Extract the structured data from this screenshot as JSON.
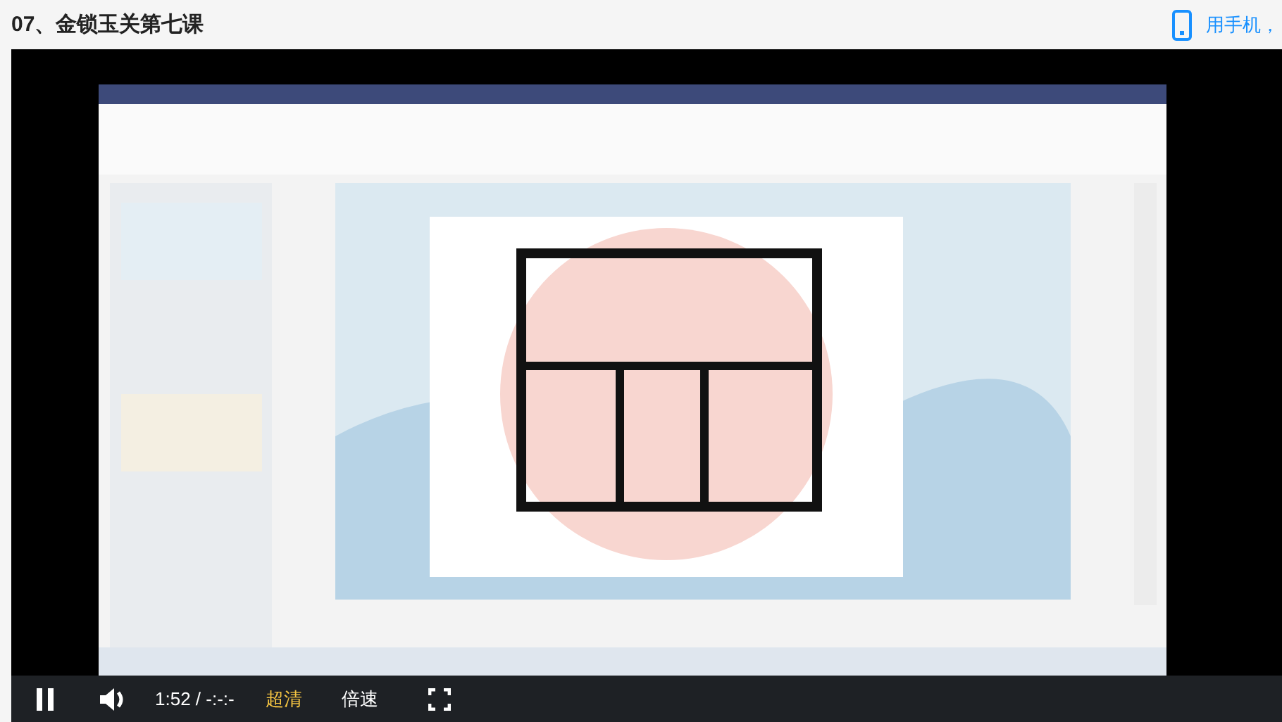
{
  "header": {
    "title": "07、金锁玉关第七课",
    "mobile_link": "用手机，"
  },
  "controls": {
    "playing": true,
    "time": "1:52 / -:-:-",
    "quality": "超清",
    "speed": "倍速"
  }
}
